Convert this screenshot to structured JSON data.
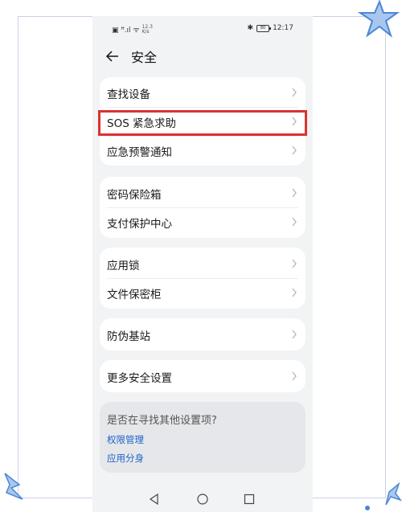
{
  "status_bar": {
    "left_text": "▣ ᴴ.ıl ᯤ",
    "speed": "12.3\nK/s",
    "bluetooth": "✱",
    "battery": "80",
    "time": "12:17"
  },
  "header": {
    "title": "安全"
  },
  "groups": [
    {
      "items": [
        {
          "label": "查找设备"
        },
        {
          "label": "SOS 紧急求助"
        },
        {
          "label": "应急预警通知"
        }
      ]
    },
    {
      "items": [
        {
          "label": "密码保险箱"
        },
        {
          "label": "支付保护中心"
        }
      ]
    },
    {
      "items": [
        {
          "label": "应用锁"
        },
        {
          "label": "文件保密柜"
        }
      ]
    },
    {
      "items": [
        {
          "label": "防伪基站"
        }
      ]
    },
    {
      "items": [
        {
          "label": "更多安全设置"
        }
      ]
    }
  ],
  "suggestion": {
    "title": "是否在寻找其他设置项?",
    "links": [
      "权限管理",
      "应用分身"
    ]
  },
  "colors": {
    "highlight": "#d9332f",
    "link": "#1d62c8",
    "background": "#f1f3f5",
    "star_accent": "#4b87d6"
  },
  "icons": {
    "back": "arrow-left-icon",
    "chevron": "chevron-right-icon",
    "nav": [
      "back-triangle-icon",
      "home-circle-icon",
      "recents-square-icon"
    ]
  }
}
